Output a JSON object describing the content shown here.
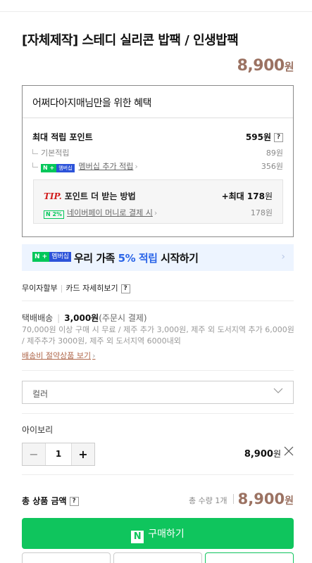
{
  "product": {
    "title": "[자체제작] 스테디 실리콘 밥팩 / 인생밥팩",
    "price": "8,900",
    "price_unit": "원"
  },
  "benefit": {
    "heading": "어쩌다아지매님만을 위한 혜택",
    "max_points_label": "최대 적립 포인트",
    "max_points_value": "595원",
    "basic_label": "기본적립",
    "basic_value": "89원",
    "badge_n": "N +",
    "badge_m": "멤버십",
    "membership_label": "멤버십 추가 적립",
    "membership_value": "356원",
    "tip_prefix": "TIP.",
    "tip_text": "포인트 더 받는 방법",
    "tip_max_prefix": "+최대",
    "tip_max_value": "178",
    "tip_max_unit": "원",
    "npay_badge": "N 2%",
    "npay_label": "네이버페이 머니로 결제 시",
    "npay_value": "178원",
    "help": "?"
  },
  "banner": {
    "badge_n": "N +",
    "badge_m": "멤버십",
    "text_prefix": "우리 가족 ",
    "pct": "5% 적립",
    "text_suffix": " 시작하기"
  },
  "installment": {
    "label1": "무이자할부",
    "label2": "카드 자세히보기",
    "help": "?"
  },
  "shipping": {
    "type": "택배배송",
    "fee": "3,000원",
    "note": "(주문시 결제)",
    "desc": "70,000원 이상 구매 시 무료 / 제주 추가 3,000원, 제주 외 도서지역 추가 6,000원 / 제주추가 3000원, 제주 외 도서지역 6000내외",
    "link": "배송비 절약상품 보기"
  },
  "option_select": {
    "label": "컬러"
  },
  "selected_option": {
    "name": "아이보리",
    "qty": "1",
    "minus": "−",
    "plus": "+",
    "price": "8,900",
    "price_unit": "원"
  },
  "total": {
    "label": "총 상품 금액",
    "help": "?",
    "count": "총 수량 1개",
    "price": "8,900",
    "price_unit": "원"
  },
  "buy": {
    "icon": "N",
    "label": "구매하기"
  },
  "colors": {
    "accent_price": "#9b7262",
    "naver_green": "#0fc55d",
    "membership_blue": "#2c53d9"
  }
}
